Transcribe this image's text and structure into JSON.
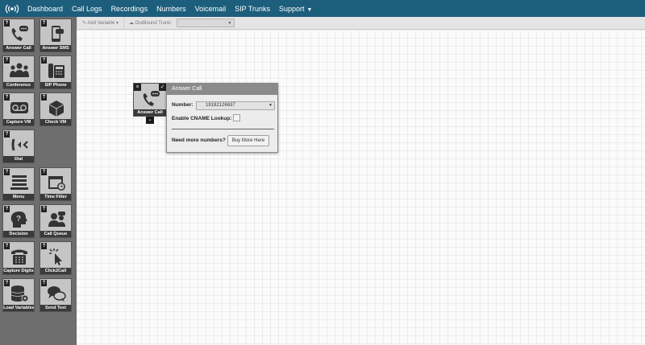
{
  "nav": {
    "items": [
      "Dashboard",
      "Call Logs",
      "Recordings",
      "Numbers",
      "Voicemail",
      "SIP Trunks",
      "Support"
    ]
  },
  "sidebar": {
    "tools": [
      {
        "label": "Answer Call",
        "icon": "phone-chat-icon"
      },
      {
        "label": "Answer SMS",
        "icon": "mobile-sms-icon"
      },
      {
        "label": "Conference",
        "icon": "conference-icon"
      },
      {
        "label": "SIP Phone",
        "icon": "sip-phone-icon"
      },
      {
        "label": "Capture VM",
        "icon": "voicemail-icon"
      },
      {
        "label": "Check VM",
        "icon": "check-box-icon"
      },
      {
        "label": "Dial",
        "icon": "dial-arrows-icon"
      },
      {
        "label": "Menu",
        "icon": "menu-icon"
      },
      {
        "label": "Time Filter",
        "icon": "calendar-clock-icon"
      },
      {
        "label": "Decision",
        "icon": "decision-head-icon"
      },
      {
        "label": "Call Queue",
        "icon": "call-queue-icon"
      },
      {
        "label": "Capture Digits",
        "icon": "keypad-phone-icon"
      },
      {
        "label": "Click2Call",
        "icon": "click-cursor-icon"
      },
      {
        "label": "Load Variables",
        "icon": "database-gear-icon"
      },
      {
        "label": "Send Text",
        "icon": "chat-bubbles-icon"
      }
    ]
  },
  "toolbar": {
    "add_variable": "Add Variable",
    "outbound_trunk": "OutBound Trunk:"
  },
  "node": {
    "label": "Answer Call"
  },
  "popup": {
    "title": "Answer Call",
    "number_label": "Number:",
    "number_value": "19182126637",
    "cname_label": "Enable CNAME Lookup:",
    "more_label": "Need more numbers?",
    "buy_button": "Buy More Here"
  },
  "colors": {
    "nav_bg": "#1c5e7c",
    "sidebar_bg": "#6e6e6e"
  }
}
